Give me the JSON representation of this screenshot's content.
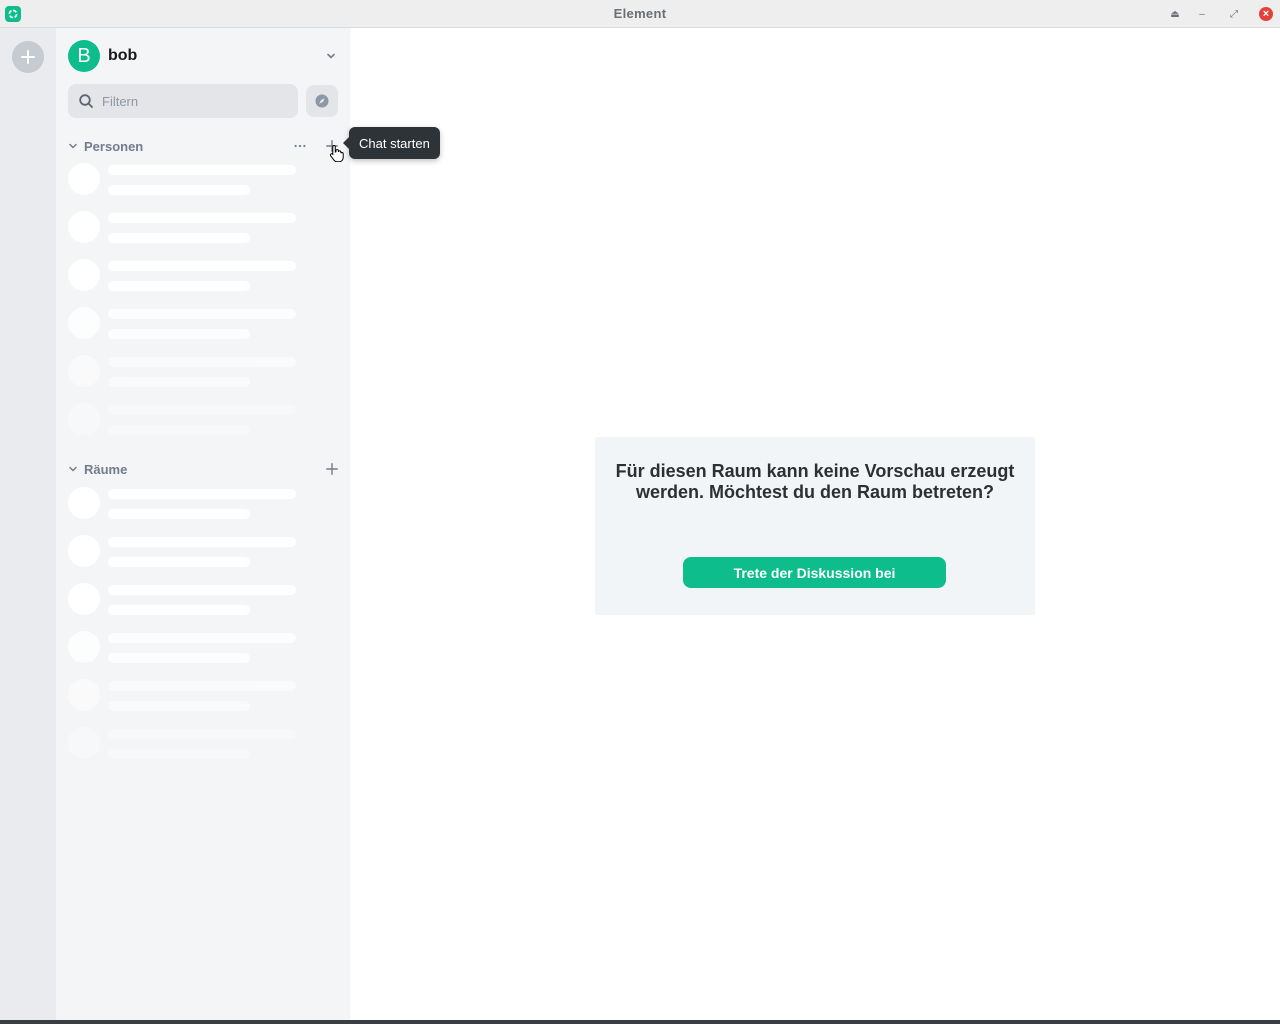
{
  "window": {
    "title": "Element",
    "app_icon": "element-logo-icon",
    "controls": [
      "eject-icon",
      "minimize-icon",
      "restore-icon",
      "close-icon"
    ]
  },
  "spacebar": {
    "add_icon": "plus-icon"
  },
  "user": {
    "avatar_letter": "B",
    "name": "bob",
    "avatar_color": "#0dbd8b"
  },
  "search": {
    "placeholder": "Filtern",
    "value": ""
  },
  "sections": {
    "people": {
      "label": "Personen",
      "skeleton_rows": 6
    },
    "rooms": {
      "label": "Räume",
      "skeleton_rows": 6
    }
  },
  "tooltip": {
    "text": "Chat starten"
  },
  "preview": {
    "message": "Für diesen Raum kann keine Vorschau erzeugt werden. Möchtest du den Raum betreten?",
    "join_label": "Trete der Diskussion bei"
  },
  "colors": {
    "accent": "#0dbd8b",
    "tooltip_bg": "#2e3338",
    "panel_bg": "#f4f5f7",
    "preview_bg": "#f2f5f8"
  }
}
